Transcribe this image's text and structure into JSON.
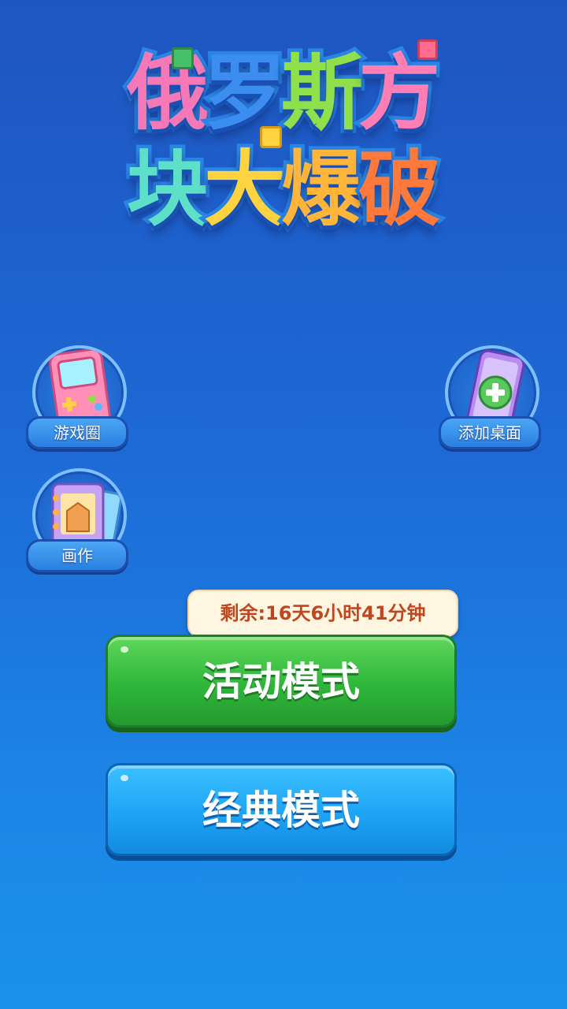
{
  "title": {
    "line1": [
      "俄",
      "罗",
      "斯",
      "方"
    ],
    "line2": [
      "块",
      "大",
      "爆",
      "破"
    ],
    "line1_colors": [
      "#f778b6",
      "#3b8df0",
      "#8fe04a",
      "#ff7fb5"
    ],
    "line2_colors": [
      "#5ee0c8",
      "#ffd23f",
      "#ffb43a",
      "#ff7a3a"
    ]
  },
  "side_buttons": {
    "game_circle": {
      "label": "游戏圈",
      "icon": "handheld-console-icon"
    },
    "add_desktop": {
      "label": "添加桌面",
      "icon": "phone-add-icon"
    },
    "artwork": {
      "label": "画作",
      "icon": "photo-album-icon"
    }
  },
  "activity": {
    "remaining_text": "剩余:16天6小时41分钟",
    "button_label": "活动模式",
    "color": "#2fb73a"
  },
  "classic": {
    "button_label": "经典模式",
    "color": "#1ea4f6"
  }
}
